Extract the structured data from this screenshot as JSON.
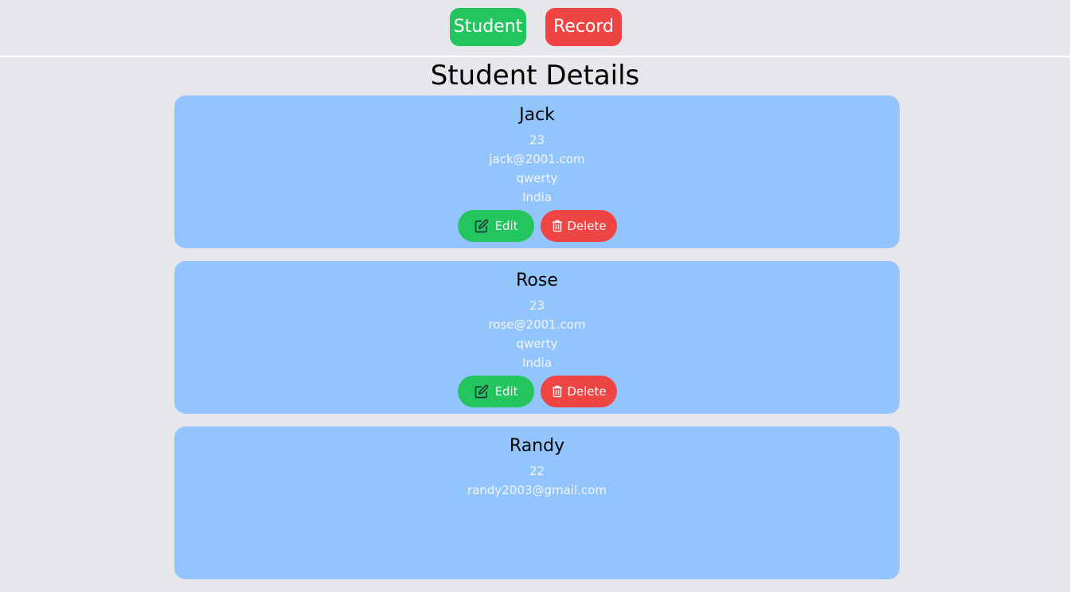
{
  "nav": {
    "student_label": "Student",
    "record_label": "Record"
  },
  "page_title": "Student Details",
  "students": [
    {
      "name": "Jack",
      "age": "23",
      "email": "jack@2001.com",
      "password": "qwerty",
      "country": "India"
    },
    {
      "name": "Rose",
      "age": "23",
      "email": "rose@2001.com",
      "password": "qwerty",
      "country": "India"
    },
    {
      "name": "Randy",
      "age": "22",
      "email": "randy2003@gmail.com",
      "password": "",
      "country": ""
    }
  ],
  "actions": {
    "edit_label": "Edit",
    "delete_label": "Delete",
    "edit_icon": "edit-icon",
    "delete_icon": "trash-icon"
  },
  "colors": {
    "background": "#e5e7eb",
    "card": "#93c5fd",
    "green": "#22c55e",
    "red": "#ef4444"
  }
}
